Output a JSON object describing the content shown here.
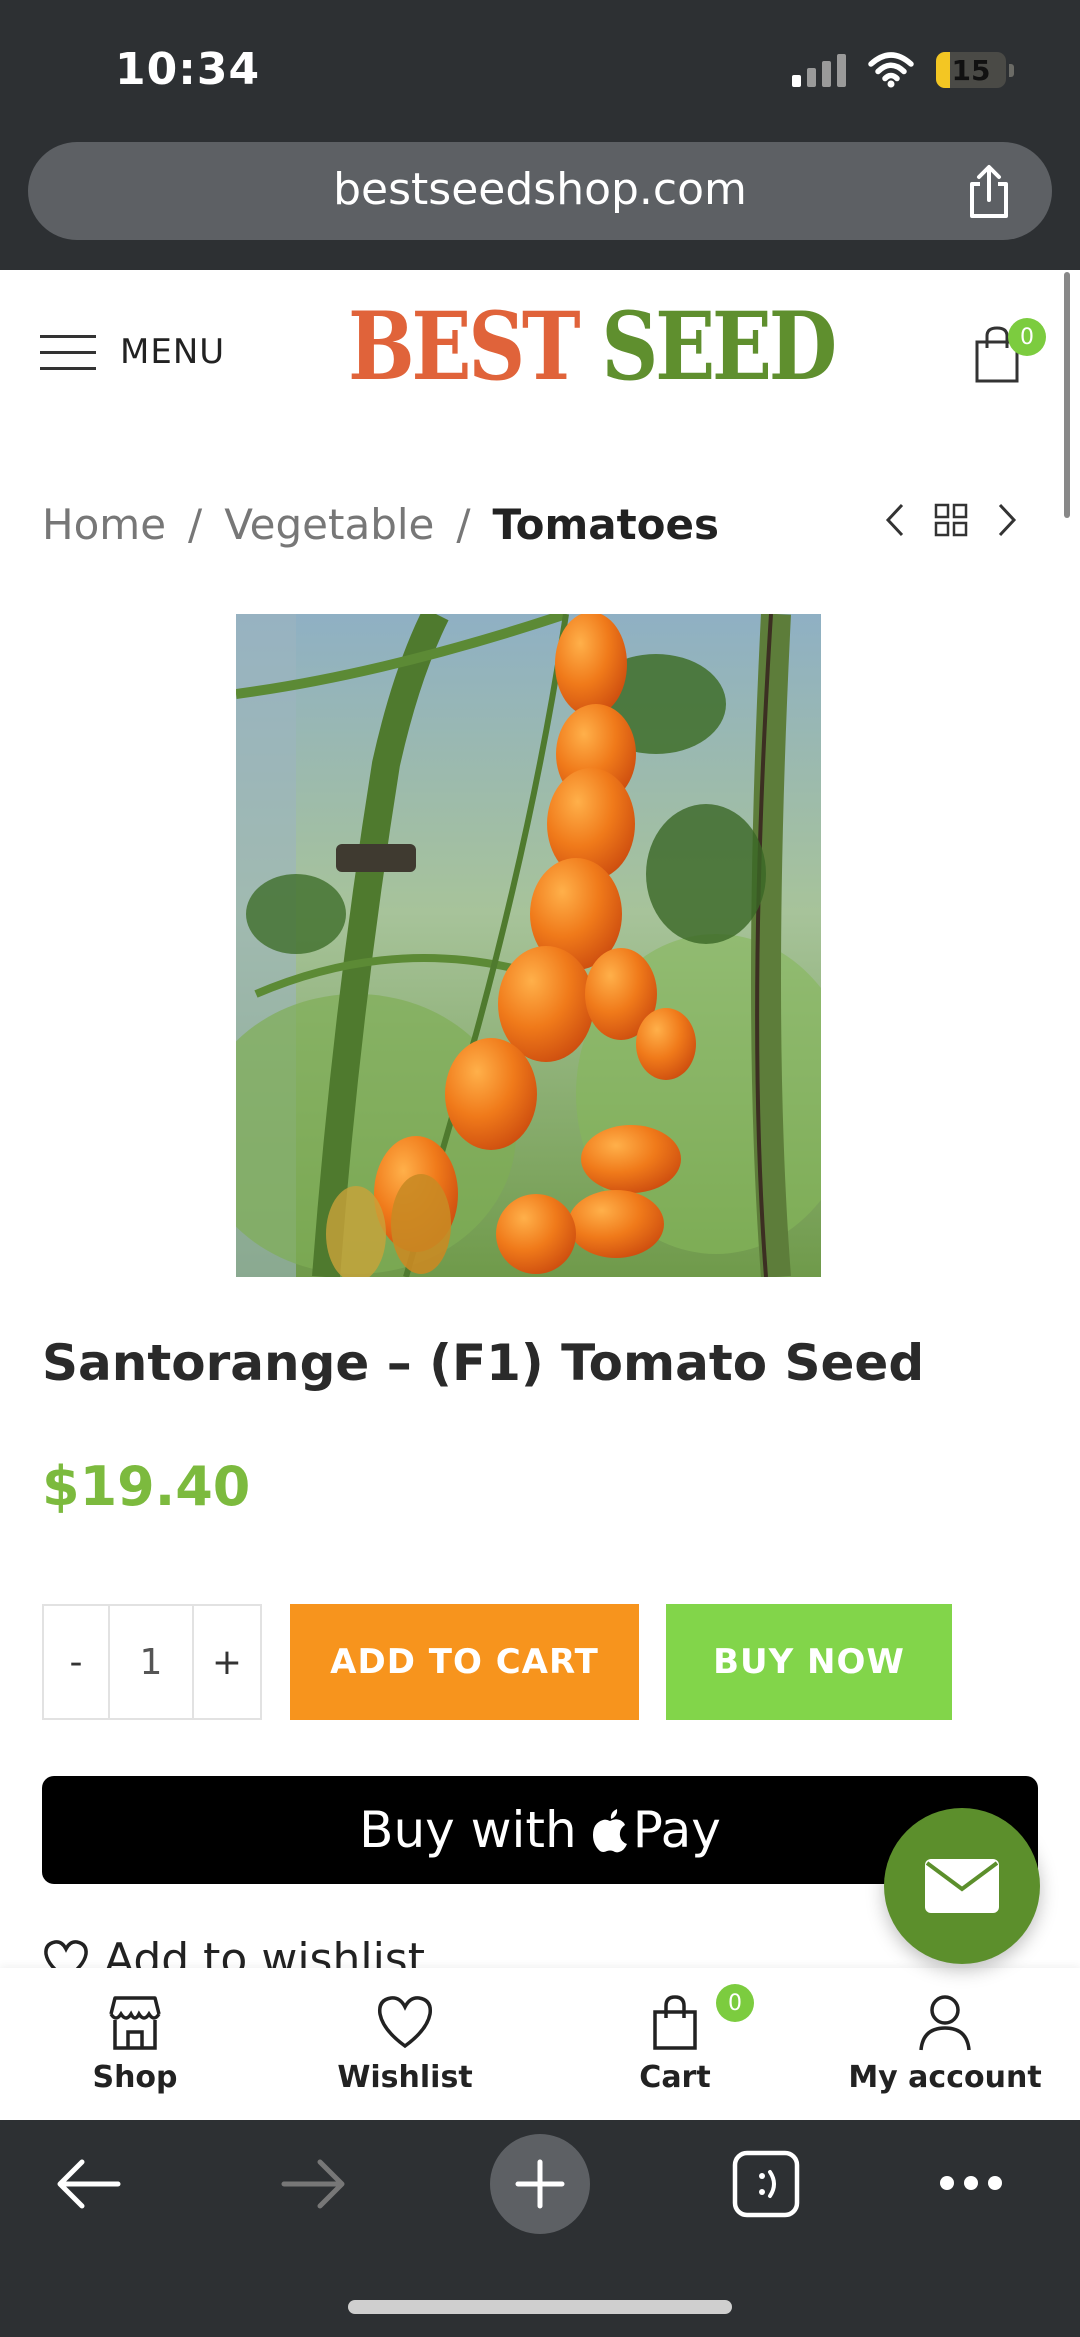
{
  "status_bar": {
    "time": "10:34",
    "battery": "15"
  },
  "browser": {
    "url": "bestseedshop.com"
  },
  "header": {
    "menu_label": "MENU",
    "logo_part1": "BEST",
    "logo_part2": "SEED",
    "cart_count": "0"
  },
  "breadcrumb": {
    "items": [
      "Home",
      "Vegetable",
      "Tomatoes"
    ],
    "separator": "/"
  },
  "product": {
    "title": "Santorange – (F1) Tomato Seed",
    "price": "$19.40",
    "quantity": "1",
    "qty_minus": "-",
    "qty_plus": "+",
    "add_to_cart_label": "ADD TO CART",
    "buy_now_label": "BUY NOW",
    "apple_pay_prefix": "Buy with",
    "apple_pay_brand": "Pay",
    "wishlist_label": "Add to wishlist"
  },
  "tabbar": {
    "items": [
      {
        "label": "Shop",
        "icon": "store-icon"
      },
      {
        "label": "Wishlist",
        "icon": "heart-icon"
      },
      {
        "label": "Cart",
        "icon": "shopping-bag-icon",
        "badge": "0"
      },
      {
        "label": "My account",
        "icon": "user-icon"
      }
    ]
  },
  "colors": {
    "accent_green": "#7cba3e",
    "add_to_cart": "#f7941d",
    "buy_now": "#82d54a",
    "logo_red": "#e0633a",
    "logo_green": "#5f8f2e",
    "chrome_bg": "#2d3033"
  }
}
